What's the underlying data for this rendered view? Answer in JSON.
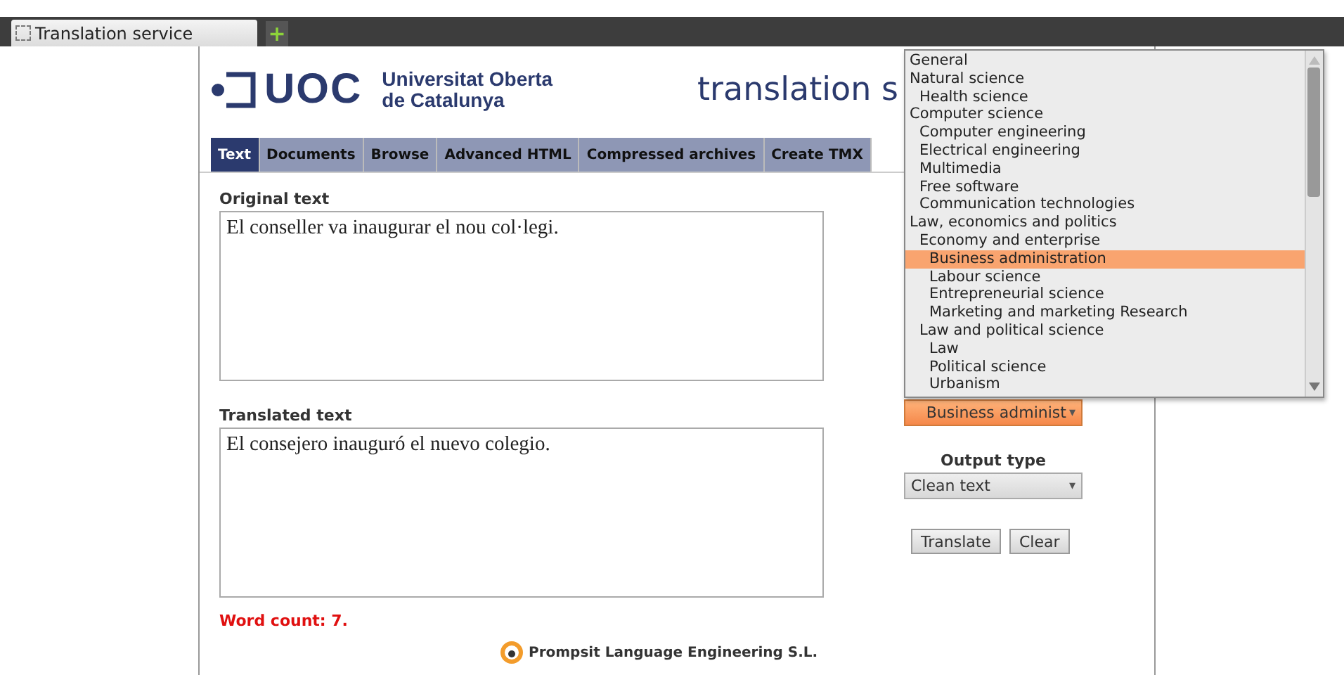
{
  "browser_tab": {
    "title": "Translation service",
    "new_tab": "+"
  },
  "header": {
    "logo_mark": "UOC",
    "logo_line_1": "Universitat Oberta",
    "logo_line_2": "de Catalunya",
    "title": "translation s"
  },
  "tabs": [
    {
      "label": "Text",
      "selected": true
    },
    {
      "label": "Documents",
      "selected": false
    },
    {
      "label": "Browse",
      "selected": false
    },
    {
      "label": "Advanced HTML",
      "selected": false
    },
    {
      "label": "Compressed archives",
      "selected": false
    },
    {
      "label": "Create TMX",
      "selected": false
    }
  ],
  "original": {
    "label": "Original text",
    "value": "El conseller va inaugurar el nou col·legi."
  },
  "translated": {
    "label": "Translated text",
    "value": "El consejero inauguró el nuevo colegio."
  },
  "word_count": "Word count: 7.",
  "footer": "Prompsit Language Engineering S.L.",
  "domain_select": {
    "value": "Business administ",
    "arrow": "▾"
  },
  "domain_list": [
    {
      "label": "General",
      "selected": false
    },
    {
      "label": "Natural science",
      "selected": false,
      "children": [
        {
          "label": "Health science",
          "selected": false
        }
      ]
    },
    {
      "label": "Computer science",
      "selected": false,
      "children": [
        {
          "label": "Computer engineering",
          "selected": false
        },
        {
          "label": "Electrical engineering",
          "selected": false
        },
        {
          "label": "Multimedia",
          "selected": false
        },
        {
          "label": "Free software",
          "selected": false
        },
        {
          "label": "Communication technologies",
          "selected": false
        }
      ]
    },
    {
      "label": "Law, economics and politics",
      "selected": false,
      "children": [
        {
          "label": "Economy and enterprise",
          "selected": false,
          "children": [
            {
              "label": "Business administration",
              "selected": true
            },
            {
              "label": "Labour science",
              "selected": false
            },
            {
              "label": "Entrepreneurial science",
              "selected": false
            },
            {
              "label": "Marketing and marketing Research",
              "selected": false
            }
          ]
        },
        {
          "label": "Law and political science",
          "selected": false,
          "children": [
            {
              "label": "Law",
              "selected": false
            },
            {
              "label": "Political science",
              "selected": false
            },
            {
              "label": "Urbanism",
              "selected": false
            }
          ]
        }
      ]
    }
  ],
  "output_type": {
    "label": "Output type",
    "value": "Clean text",
    "arrow": "▾"
  },
  "buttons": [
    "Translate",
    "Clear"
  ]
}
